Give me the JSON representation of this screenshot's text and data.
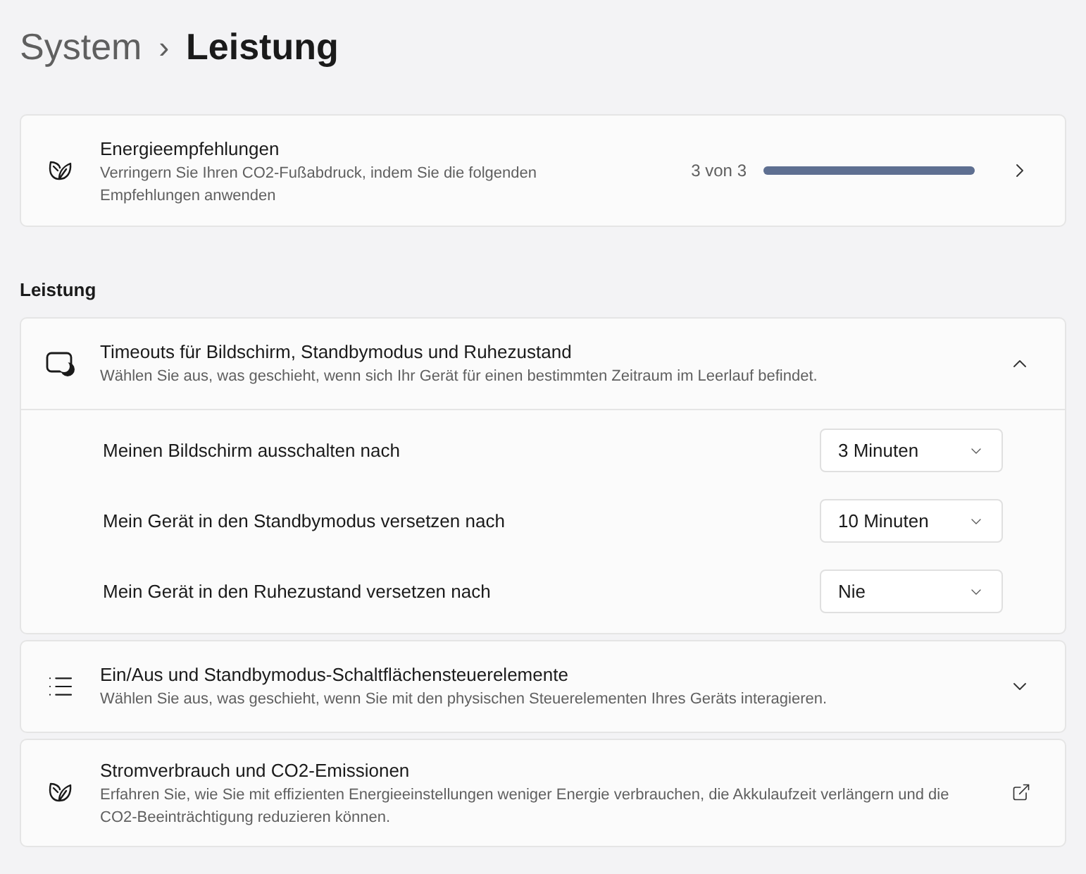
{
  "breadcrumb": {
    "parent": "System",
    "separator": "›",
    "current": "Leistung"
  },
  "recommendation": {
    "title": "Energieempfehlungen",
    "description": "Verringern Sie Ihren CO2-Fußabdruck, indem Sie die folgenden Empfehlungen anwenden",
    "progress_text": "3 von 3",
    "level": 1
  },
  "section_title": "Leistung",
  "cards": [
    {
      "kind": "expander",
      "title": "Timeouts für Bildschirm, Standbymodus und Ruhezustand",
      "description": "Wählen Sie aus, was geschieht, wenn sich Ihr Gerät für einen bestimmten Zeitraum im Leerlauf befindet.",
      "expanded": true,
      "settings": [
        {
          "label": "Meinen Bildschirm ausschalten nach",
          "value": "3 Minuten"
        },
        {
          "label": "Mein Gerät in den Standbymodus versetzen nach",
          "value": "10 Minuten"
        },
        {
          "label": "Mein Gerät in den Ruhezustand versetzen nach",
          "value": "Nie"
        }
      ]
    },
    {
      "kind": "expander",
      "title": "Ein/Aus und Standbymodus-Schaltflächensteuerelemente",
      "description": "Wählen Sie aus, was geschieht, wenn Sie mit den physischen Steuerelementen Ihres Geräts interagieren.",
      "expanded": false
    },
    {
      "kind": "link",
      "title": "Stromverbrauch und CO2-Emissionen",
      "description": "Erfahren Sie, wie Sie mit effizienten Energieeinstellungen weniger Energie verbrauchen, die Akkulaufzeit verlängern und die CO2-Beeinträchtigung reduzieren können."
    }
  ]
}
